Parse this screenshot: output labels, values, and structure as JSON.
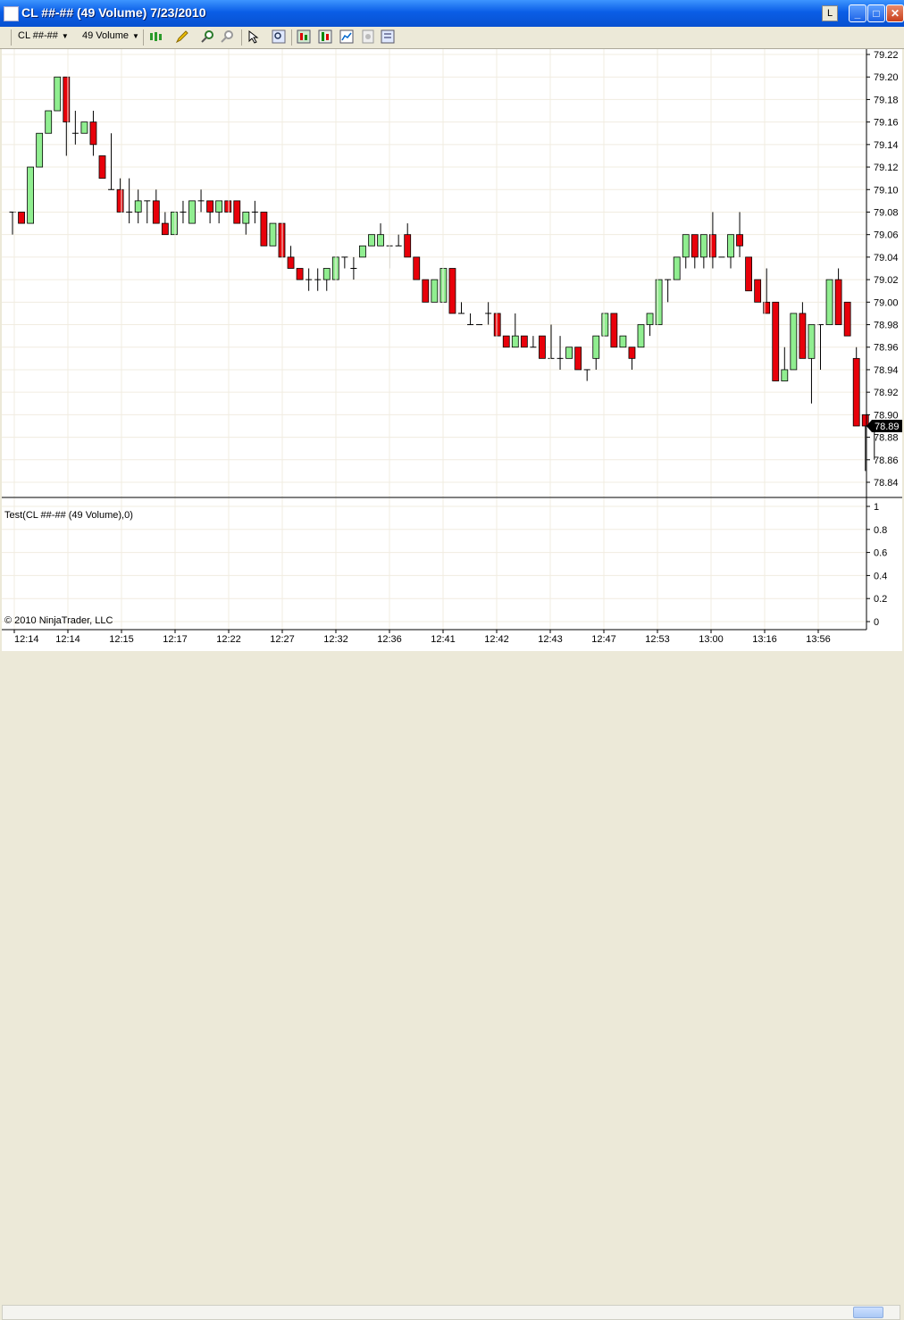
{
  "window": {
    "title": "CL ##-## (49 Volume)  7/23/2010",
    "l_button": "L",
    "minimize_glyph": "_",
    "maximize_glyph": "□",
    "close_glyph": "✕"
  },
  "toolbar": {
    "instrument": "CL ##-##",
    "period": "49 Volume",
    "icons": [
      "candlestick-icon",
      "pencil-icon",
      "zoom-in-icon",
      "zoom-out-icon",
      "pointer-icon",
      "magnifier-icon",
      "strategies-icon",
      "indicators-icon",
      "chart-style-icon",
      "data-box-icon",
      "properties-icon"
    ]
  },
  "colors": {
    "up": "#90ee90",
    "down": "#e8000a",
    "grid": "#f1ece0"
  },
  "price_badge": "78.89",
  "copyright": "© 2010 NinjaTrader, LLC",
  "chart_data": [
    {
      "type": "candlestick",
      "series_name": "CL ##-## (49 Volume)",
      "y_ticks": [
        "79.22",
        "79.20",
        "79.18",
        "79.16",
        "79.14",
        "79.12",
        "79.10",
        "79.08",
        "79.06",
        "79.04",
        "79.02",
        "79.00",
        "78.98",
        "78.96",
        "78.94",
        "78.92",
        "78.90",
        "78.88",
        "78.86",
        "78.84"
      ],
      "ylim": [
        78.83,
        79.22
      ],
      "x_labels": [
        "12:14",
        "12:14",
        "12:15",
        "12:17",
        "12:22",
        "12:27",
        "12:32",
        "12:36",
        "12:41",
        "12:42",
        "12:43",
        "12:47",
        "12:53",
        "13:00",
        "13:16",
        "13:56"
      ],
      "last_price": 78.89,
      "candles": [
        {
          "o": 79.08,
          "h": 79.08,
          "l": 79.06,
          "c": 79.08
        },
        {
          "o": 79.08,
          "h": 79.08,
          "l": 79.07,
          "c": 79.07
        },
        {
          "o": 79.07,
          "h": 79.12,
          "l": 79.07,
          "c": 79.12
        },
        {
          "o": 79.12,
          "h": 79.15,
          "l": 79.12,
          "c": 79.15
        },
        {
          "o": 79.15,
          "h": 79.17,
          "l": 79.15,
          "c": 79.17
        },
        {
          "o": 79.17,
          "h": 79.2,
          "l": 79.17,
          "c": 79.2
        },
        {
          "o": 79.2,
          "h": 79.2,
          "l": 79.13,
          "c": 79.16
        },
        {
          "o": 79.15,
          "h": 79.17,
          "l": 79.14,
          "c": 79.15
        },
        {
          "o": 79.15,
          "h": 79.16,
          "l": 79.15,
          "c": 79.16
        },
        {
          "o": 79.16,
          "h": 79.17,
          "l": 79.13,
          "c": 79.14
        },
        {
          "o": 79.13,
          "h": 79.13,
          "l": 79.11,
          "c": 79.11
        },
        {
          "o": 79.1,
          "h": 79.15,
          "l": 79.1,
          "c": 79.1
        },
        {
          "o": 79.1,
          "h": 79.11,
          "l": 79.08,
          "c": 79.08
        },
        {
          "o": 79.08,
          "h": 79.11,
          "l": 79.07,
          "c": 79.08
        },
        {
          "o": 79.08,
          "h": 79.1,
          "l": 79.07,
          "c": 79.09
        },
        {
          "o": 79.09,
          "h": 79.09,
          "l": 79.07,
          "c": 79.09
        },
        {
          "o": 79.09,
          "h": 79.1,
          "l": 79.07,
          "c": 79.07
        },
        {
          "o": 79.07,
          "h": 79.08,
          "l": 79.06,
          "c": 79.06
        },
        {
          "o": 79.06,
          "h": 79.08,
          "l": 79.06,
          "c": 79.08
        },
        {
          "o": 79.08,
          "h": 79.09,
          "l": 79.07,
          "c": 79.08
        },
        {
          "o": 79.07,
          "h": 79.09,
          "l": 79.07,
          "c": 79.09
        },
        {
          "o": 79.09,
          "h": 79.1,
          "l": 79.08,
          "c": 79.09
        },
        {
          "o": 79.09,
          "h": 79.09,
          "l": 79.07,
          "c": 79.08
        },
        {
          "o": 79.08,
          "h": 79.09,
          "l": 79.07,
          "c": 79.09
        },
        {
          "o": 79.09,
          "h": 79.09,
          "l": 79.08,
          "c": 79.08
        },
        {
          "o": 79.09,
          "h": 79.09,
          "l": 79.07,
          "c": 79.07
        },
        {
          "o": 79.07,
          "h": 79.08,
          "l": 79.06,
          "c": 79.08
        },
        {
          "o": 79.08,
          "h": 79.09,
          "l": 79.07,
          "c": 79.08
        },
        {
          "o": 79.08,
          "h": 79.08,
          "l": 79.05,
          "c": 79.05
        },
        {
          "o": 79.05,
          "h": 79.07,
          "l": 79.05,
          "c": 79.07
        },
        {
          "o": 79.07,
          "h": 79.07,
          "l": 79.04,
          "c": 79.04
        },
        {
          "o": 79.04,
          "h": 79.05,
          "l": 79.03,
          "c": 79.03
        },
        {
          "o": 79.03,
          "h": 79.03,
          "l": 79.02,
          "c": 79.02
        },
        {
          "o": 79.02,
          "h": 79.03,
          "l": 79.01,
          "c": 79.02
        },
        {
          "o": 79.02,
          "h": 79.03,
          "l": 79.01,
          "c": 79.02
        },
        {
          "o": 79.02,
          "h": 79.03,
          "l": 79.01,
          "c": 79.03
        },
        {
          "o": 79.02,
          "h": 79.04,
          "l": 79.02,
          "c": 79.04
        },
        {
          "o": 79.04,
          "h": 79.04,
          "l": 79.03,
          "c": 79.04
        },
        {
          "o": 79.03,
          "h": 79.04,
          "l": 79.02,
          "c": 79.03
        },
        {
          "o": 79.04,
          "h": 79.05,
          "l": 79.04,
          "c": 79.05
        },
        {
          "o": 79.05,
          "h": 79.06,
          "l": 79.05,
          "c": 79.06
        },
        {
          "o": 79.05,
          "h": 79.07,
          "l": 79.05,
          "c": 79.06
        },
        {
          "o": 79.05,
          "h": 79.05,
          "l": 79.03,
          "c": 79.05
        },
        {
          "o": 79.05,
          "h": 79.06,
          "l": 79.05,
          "c": 79.05
        },
        {
          "o": 79.06,
          "h": 79.07,
          "l": 79.04,
          "c": 79.04
        },
        {
          "o": 79.04,
          "h": 79.04,
          "l": 79.02,
          "c": 79.02
        },
        {
          "o": 79.02,
          "h": 79.02,
          "l": 79.0,
          "c": 79.0
        },
        {
          "o": 79.0,
          "h": 79.02,
          "l": 79.0,
          "c": 79.02
        },
        {
          "o": 79.0,
          "h": 79.03,
          "l": 79.0,
          "c": 79.03
        },
        {
          "o": 79.03,
          "h": 79.03,
          "l": 78.99,
          "c": 78.99
        },
        {
          "o": 78.99,
          "h": 79.0,
          "l": 78.99,
          "c": 78.99
        },
        {
          "o": 78.98,
          "h": 78.99,
          "l": 78.98,
          "c": 78.98
        },
        {
          "o": 78.98,
          "h": 78.98,
          "l": 78.98,
          "c": 78.98
        },
        {
          "o": 78.99,
          "h": 79.0,
          "l": 78.98,
          "c": 78.99
        },
        {
          "o": 78.99,
          "h": 78.99,
          "l": 78.97,
          "c": 78.97
        },
        {
          "o": 78.97,
          "h": 78.97,
          "l": 78.96,
          "c": 78.96
        },
        {
          "o": 78.96,
          "h": 78.99,
          "l": 78.96,
          "c": 78.97
        },
        {
          "o": 78.97,
          "h": 78.97,
          "l": 78.96,
          "c": 78.96
        },
        {
          "o": 78.96,
          "h": 78.97,
          "l": 78.96,
          "c": 78.96
        },
        {
          "o": 78.97,
          "h": 78.97,
          "l": 78.95,
          "c": 78.95
        },
        {
          "o": 78.95,
          "h": 78.98,
          "l": 78.95,
          "c": 78.95
        },
        {
          "o": 78.95,
          "h": 78.97,
          "l": 78.94,
          "c": 78.95
        },
        {
          "o": 78.95,
          "h": 78.96,
          "l": 78.95,
          "c": 78.96
        },
        {
          "o": 78.96,
          "h": 78.96,
          "l": 78.94,
          "c": 78.94
        },
        {
          "o": 78.94,
          "h": 78.94,
          "l": 78.93,
          "c": 78.94
        },
        {
          "o": 78.95,
          "h": 78.97,
          "l": 78.94,
          "c": 78.97
        },
        {
          "o": 78.97,
          "h": 78.99,
          "l": 78.97,
          "c": 78.99
        },
        {
          "o": 78.99,
          "h": 78.99,
          "l": 78.96,
          "c": 78.96
        },
        {
          "o": 78.96,
          "h": 78.97,
          "l": 78.96,
          "c": 78.97
        },
        {
          "o": 78.96,
          "h": 78.96,
          "l": 78.94,
          "c": 78.95
        },
        {
          "o": 78.96,
          "h": 78.98,
          "l": 78.96,
          "c": 78.98
        },
        {
          "o": 78.98,
          "h": 78.99,
          "l": 78.97,
          "c": 78.99
        },
        {
          "o": 78.98,
          "h": 79.02,
          "l": 78.98,
          "c": 79.02
        },
        {
          "o": 79.02,
          "h": 79.02,
          "l": 79.0,
          "c": 79.02
        },
        {
          "o": 79.02,
          "h": 79.04,
          "l": 79.02,
          "c": 79.04
        },
        {
          "o": 79.04,
          "h": 79.06,
          "l": 79.03,
          "c": 79.06
        },
        {
          "o": 79.06,
          "h": 79.06,
          "l": 79.03,
          "c": 79.04
        },
        {
          "o": 79.04,
          "h": 79.06,
          "l": 79.03,
          "c": 79.06
        },
        {
          "o": 79.06,
          "h": 79.08,
          "l": 79.03,
          "c": 79.04
        },
        {
          "o": 79.04,
          "h": 79.04,
          "l": 79.04,
          "c": 79.04
        },
        {
          "o": 79.04,
          "h": 79.06,
          "l": 79.03,
          "c": 79.06
        },
        {
          "o": 79.06,
          "h": 79.08,
          "l": 79.04,
          "c": 79.05
        },
        {
          "o": 79.04,
          "h": 79.04,
          "l": 79.01,
          "c": 79.01
        },
        {
          "o": 79.02,
          "h": 79.02,
          "l": 79.0,
          "c": 79.0
        },
        {
          "o": 79.0,
          "h": 79.03,
          "l": 78.99,
          "c": 78.99
        },
        {
          "o": 79.0,
          "h": 79.0,
          "l": 78.93,
          "c": 78.93
        },
        {
          "o": 78.93,
          "h": 78.96,
          "l": 78.93,
          "c": 78.94
        },
        {
          "o": 78.94,
          "h": 78.99,
          "l": 78.94,
          "c": 78.99
        },
        {
          "o": 78.99,
          "h": 79.0,
          "l": 78.95,
          "c": 78.95
        },
        {
          "o": 78.95,
          "h": 78.98,
          "l": 78.91,
          "c": 78.98
        },
        {
          "o": 78.98,
          "h": 78.98,
          "l": 78.94,
          "c": 78.98
        },
        {
          "o": 78.98,
          "h": 79.02,
          "l": 78.98,
          "c": 79.02
        },
        {
          "o": 79.02,
          "h": 79.03,
          "l": 78.98,
          "c": 78.98
        },
        {
          "o": 79.0,
          "h": 79.0,
          "l": 78.97,
          "c": 78.97
        },
        {
          "o": 78.95,
          "h": 78.96,
          "l": 78.89,
          "c": 78.89
        },
        {
          "o": 78.9,
          "h": 78.9,
          "l": 78.85,
          "c": 78.89
        },
        {
          "o": 78.89,
          "h": 78.89,
          "l": 78.86,
          "c": 78.89
        }
      ]
    },
    {
      "type": "line",
      "series_name": "Test(CL ##-## (49 Volume),0)",
      "y_ticks": [
        "1",
        "0.8",
        "0.6",
        "0.4",
        "0.2",
        "0"
      ],
      "ylim": [
        0,
        1
      ],
      "values": []
    }
  ]
}
